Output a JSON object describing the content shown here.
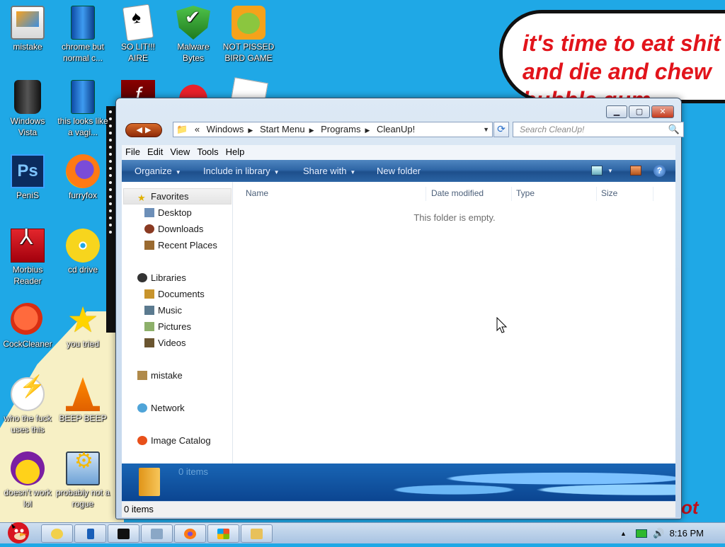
{
  "bubble": {
    "text": "it's time to eat shit\nand die and chew\nbubble gum",
    "corner_text": "ot"
  },
  "desktop_icons": [
    {
      "label": "mistake"
    },
    {
      "label": "chrome but normal c..."
    },
    {
      "label": "SO LIT!!! AIRE"
    },
    {
      "label": "Malware Bytes"
    },
    {
      "label": "NOT PISSED BIRD GAME"
    },
    {
      "label": "Windows Vista"
    },
    {
      "label": "this looks like a vagi..."
    },
    {
      "label": "PeniS"
    },
    {
      "label": "furryfox"
    },
    {
      "label": "Morbius Reader"
    },
    {
      "label": "cd drive"
    },
    {
      "label": "CockCleaner"
    },
    {
      "label": "you tried"
    },
    {
      "label": "who the fuck uses this"
    },
    {
      "label": "BEEP BEEP"
    },
    {
      "label": "doesn't work lol"
    },
    {
      "label": "probably not a rogue"
    }
  ],
  "window": {
    "address": {
      "overflow": "«",
      "segments": [
        "Windows",
        "Start Menu",
        "Programs",
        "CleanUp!"
      ]
    },
    "search_placeholder": "Search CleanUp!",
    "menu": [
      "File",
      "Edit",
      "View",
      "Tools",
      "Help"
    ],
    "commands": {
      "organize": "Organize",
      "include": "Include in library",
      "share": "Share with",
      "new_folder": "New folder"
    },
    "nav": {
      "favorites": "Favorites",
      "desktop": "Desktop",
      "downloads": "Downloads",
      "recent": "Recent Places",
      "libraries": "Libraries",
      "documents": "Documents",
      "music": "Music",
      "pictures": "Pictures",
      "videos": "Videos",
      "mistake": "mistake",
      "network": "Network",
      "image_catalog": "Image Catalog"
    },
    "columns": [
      "Name",
      "Date modified",
      "Type",
      "Size"
    ],
    "empty_message": "This folder is empty.",
    "details_count": "0 items",
    "status": "0 items"
  },
  "taskbar": {
    "clock": "8:16 PM"
  },
  "colors": {
    "desktop": "#1fa8e6",
    "bubble_text": "#e2141b",
    "command_bar": "#2f66a6"
  }
}
